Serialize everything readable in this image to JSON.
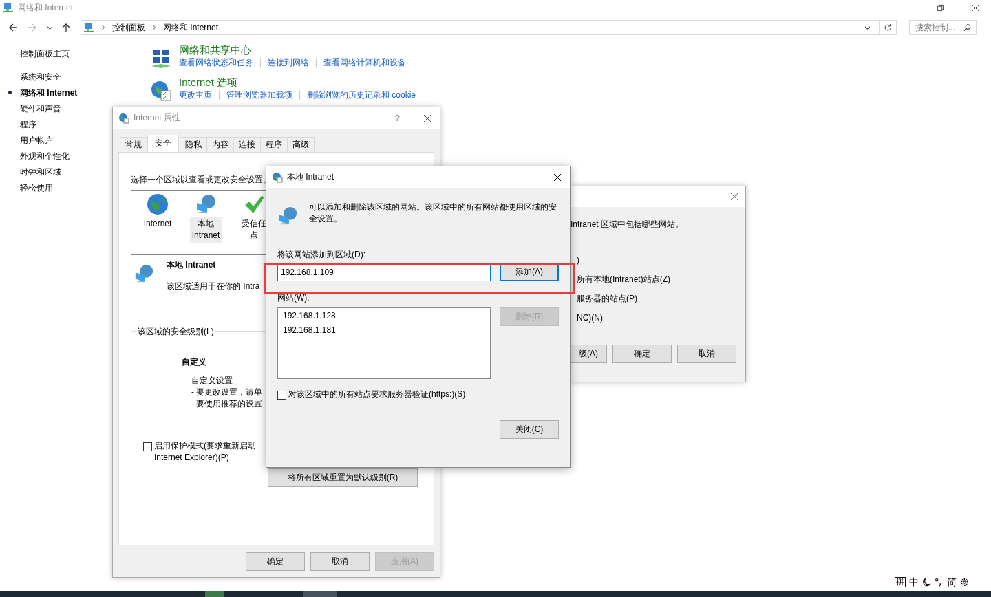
{
  "main_window": {
    "title": "网络和 Internet",
    "breadcrumb": [
      "控制面板",
      "网络和 Internet"
    ],
    "search": {
      "placeholder": "搜索控制..."
    }
  },
  "sidebar": {
    "home": "控制面板主页",
    "items": [
      {
        "label": "系统和安全",
        "selected": false
      },
      {
        "label": "网络和 Internet",
        "selected": true
      },
      {
        "label": "硬件和声音",
        "selected": false
      },
      {
        "label": "程序",
        "selected": false
      },
      {
        "label": "用户帐户",
        "selected": false
      },
      {
        "label": "外观和个性化",
        "selected": false
      },
      {
        "label": "时钟和区域",
        "selected": false
      },
      {
        "label": "轻松使用",
        "selected": false
      }
    ]
  },
  "categories": [
    {
      "kind": "network",
      "title": "网络和共享中心",
      "links": [
        "查看网络状态和任务",
        "连接到网络",
        "查看网络计算机和设备"
      ]
    },
    {
      "kind": "internet",
      "title": "Internet 选项",
      "links": [
        "更改主页",
        "管理浏览器加载项",
        "删除浏览的历史记录和 cookie"
      ]
    }
  ],
  "internet_properties": {
    "title": "Internet 属性",
    "help": "?",
    "tabs": [
      {
        "label": "常规",
        "selected": false
      },
      {
        "label": "安全",
        "selected": true
      },
      {
        "label": "隐私",
        "selected": false
      },
      {
        "label": "内容",
        "selected": false
      },
      {
        "label": "连接",
        "selected": false
      },
      {
        "label": "程序",
        "selected": false
      },
      {
        "label": "高级",
        "selected": false
      }
    ],
    "prompt": "选择一个区域以查看或更改安全设置。",
    "zones": [
      {
        "kind": "internet",
        "lines": [
          "Internet"
        ],
        "selected": false
      },
      {
        "kind": "intranet",
        "lines": [
          "本地",
          "Intranet"
        ],
        "selected": true
      },
      {
        "kind": "trusted",
        "lines": [
          "受信任",
          "点"
        ],
        "selected": false
      }
    ],
    "zone_name": "本地 Intranet",
    "zone_description": "该区域适用于在你的 Intra",
    "level_group": "该区域的安全级别(L)",
    "level_title": "自定义",
    "level_lines": [
      "自定义设置",
      "- 要更改设置，请单",
      "- 要使用推荐的设置"
    ],
    "protected_mode": {
      "lines": [
        "启用保护模式(要求重新启动",
        "Internet Explorer)(P)"
      ],
      "checked": false
    },
    "reset_button": "将所有区域重置为默认级别(R)",
    "buttons": [
      {
        "label": "确定",
        "disabled": false
      },
      {
        "label": "取消",
        "disabled": false
      },
      {
        "label": "应用(A)",
        "disabled": true
      }
    ]
  },
  "sites_dialog": {
    "intro": "Intranet 区域中包括哪些网站。",
    "options": [
      ")",
      "所有本地(Intranet)站点(Z)",
      "服务器的站点(P)",
      "NC)(N)"
    ],
    "buttons": [
      "级(A)",
      "确定",
      "取消"
    ]
  },
  "intranet_dialog": {
    "title": "本地 Intranet",
    "message": "可以添加和删除该区域的网站。该区域中的所有网站都使用区域的安全设置。",
    "add_label": "将该网站添加到区域(D):",
    "add_value": "192.168.1.109",
    "add_button": {
      "label": "添加(A)",
      "disabled": false
    },
    "sites_label": "网站(W):",
    "sites": [
      "192.168.1.128",
      "192.168.1.181"
    ],
    "remove_button": {
      "label": "删除(R)",
      "disabled": true
    },
    "require_https": {
      "label": "对该区域中的所有站点要求服务器验证(https:)(S)",
      "checked": false
    },
    "close_button": "关闭(C)"
  },
  "ime": [
    "拼",
    "中",
    "简"
  ]
}
